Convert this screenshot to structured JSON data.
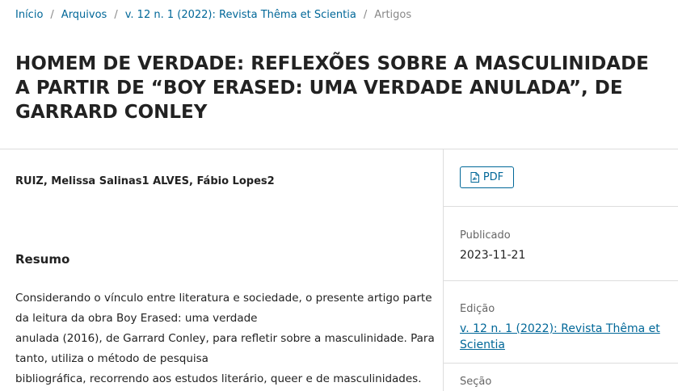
{
  "breadcrumb": {
    "home": "Início",
    "archives": "Arquivos",
    "issue": "v. 12 n. 1 (2022): Revista Thêma et Scientia",
    "current": "Artigos",
    "separator": "/"
  },
  "article": {
    "title": "HOMEM DE VERDADE: REFLEXÕES SOBRE A MASCULINIDADE A PARTIR DE “BOY ERASED: UMA VERDADE ANULADA”, DE GARRARD CONLEY",
    "authors": "RUIZ, Melissa Salinas1 ALVES, Fábio Lopes2",
    "abstract_heading": "Resumo",
    "abstract_lines": [
      "Considerando o vínculo entre literatura e sociedade, o presente artigo parte",
      "da leitura da obra Boy Erased: uma verdade",
      "anulada (2016), de Garrard Conley, para refletir sobre a masculinidade. Para",
      "tanto, utiliza o método de pesquisa",
      "bibliográfica, recorrendo aos estudos literário, queer e de masculinidades."
    ]
  },
  "sidebar": {
    "pdf_label": "PDF",
    "published_label": "Publicado",
    "published_value": "2023-11-21",
    "issue_label": "Edição",
    "issue_link": "v. 12 n. 1 (2022): Revista Thêma et Scientia",
    "section_label": "Seção"
  },
  "colors": {
    "link": "#006798",
    "text": "#222222",
    "muted": "#888888",
    "divider": "#dddddd"
  },
  "icons": {
    "pdf": "file-pdf-icon"
  }
}
